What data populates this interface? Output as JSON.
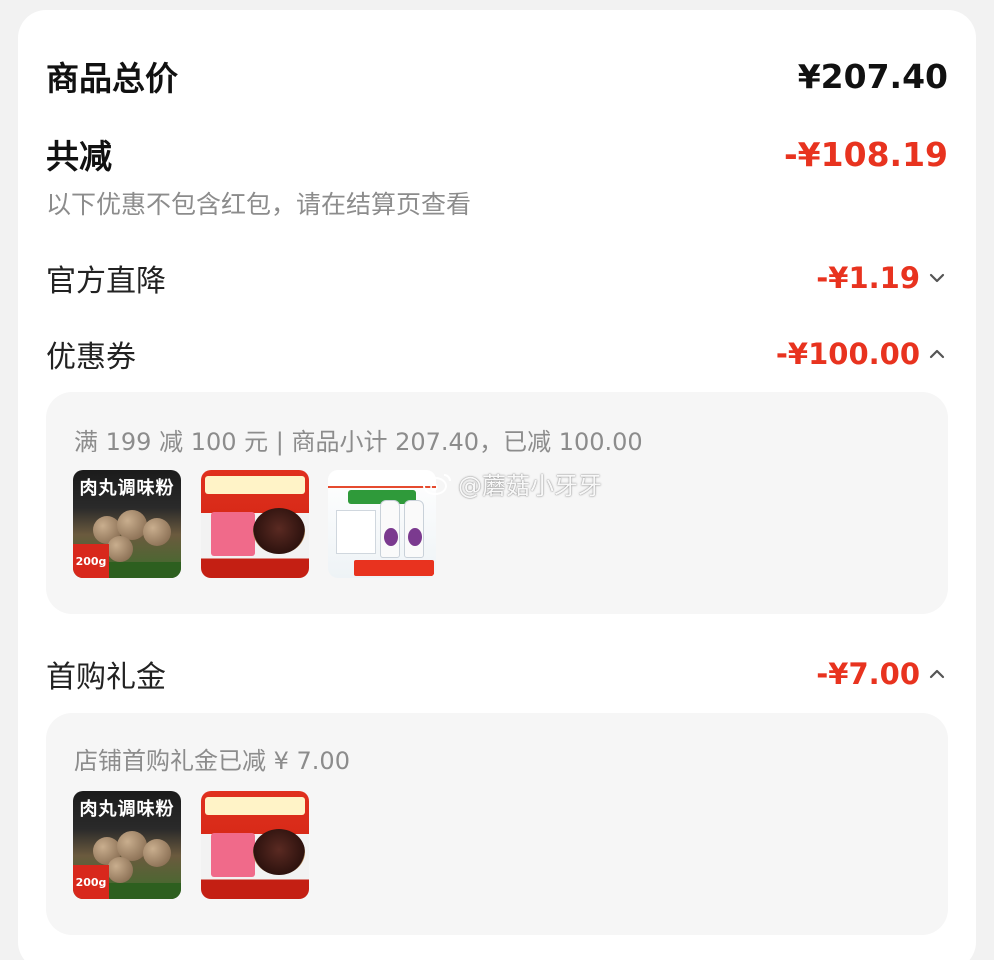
{
  "summary": {
    "total_label": "商品总价",
    "total_value": "¥207.40",
    "discount_label": "共减",
    "discount_value": "-¥108.19",
    "discount_note": "以下优惠不包含红包，请在结算页查看"
  },
  "items": [
    {
      "label": "官方直降",
      "value": "-¥1.19",
      "expanded": false
    },
    {
      "label": "优惠券",
      "value": "-¥100.00",
      "expanded": true
    },
    {
      "label": "首购礼金",
      "value": "-¥7.00",
      "expanded": true
    }
  ],
  "coupon_panel": {
    "text": "满 199 减 100 元 | 商品小计 207.40，已减 100.00",
    "products": [
      "meatball-seasoning",
      "congee",
      "grape-juice"
    ]
  },
  "first_purchase_panel": {
    "text": "店铺首购礼金已减 ¥ 7.00",
    "products": [
      "meatball-seasoning",
      "congee"
    ]
  },
  "watermark": "@蘑菇小牙牙",
  "colors": {
    "accent_red": "#e8331f",
    "panel_bg": "#f6f6f6",
    "muted_text": "#8c8c8c"
  }
}
